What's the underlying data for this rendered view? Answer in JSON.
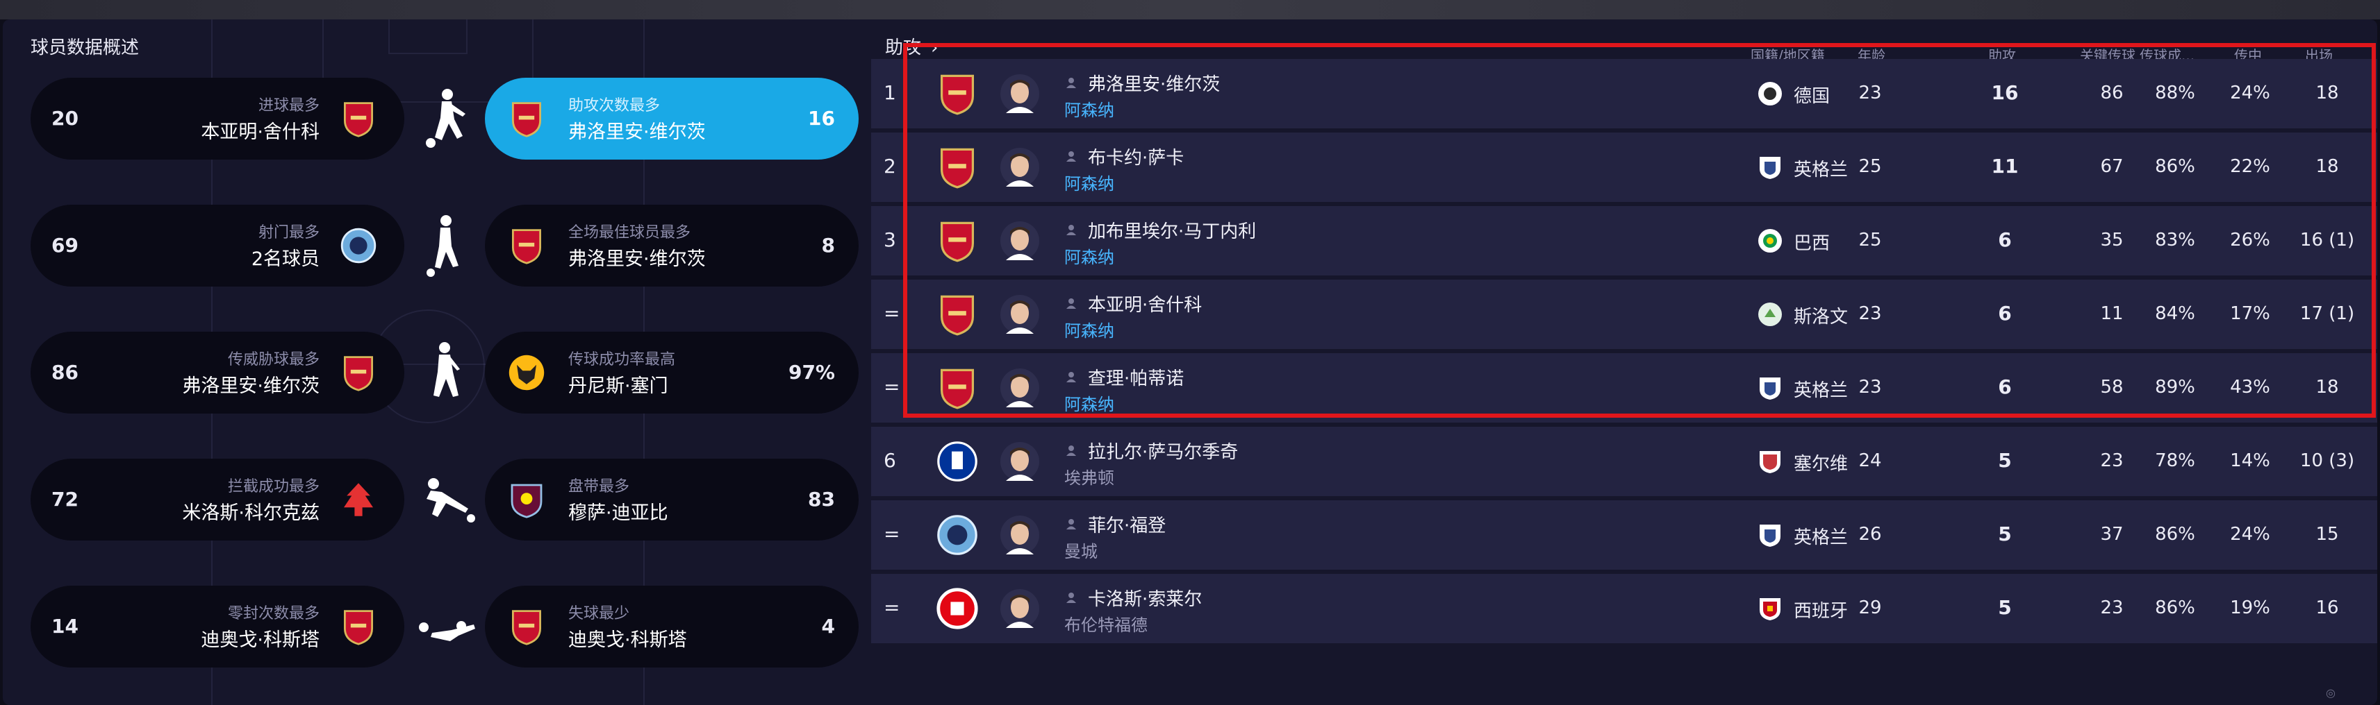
{
  "overview": {
    "title": "球员数据概述",
    "rows": [
      {
        "left": {
          "value": "20",
          "category": "进球最多",
          "player": "本亚明·舍什科",
          "crest": "arsenal-crest"
        },
        "right": {
          "value": "16",
          "category": "助攻次数最多",
          "player": "弗洛里安·维尔茨",
          "crest": "arsenal-crest",
          "highlighted": true
        }
      },
      {
        "left": {
          "value": "69",
          "category": "射门最多",
          "player": "2名球员",
          "crest": "man-city-crest"
        },
        "right": {
          "value": "8",
          "category": "全场最佳球员最多",
          "player": "弗洛里安·维尔茨",
          "crest": "arsenal-crest"
        }
      },
      {
        "left": {
          "value": "86",
          "category": "传威胁球最多",
          "player": "弗洛里安·维尔茨",
          "crest": "arsenal-crest"
        },
        "right": {
          "value": "97%",
          "category": "传球成功率最高",
          "player": "丹尼斯·塞门",
          "crest": "wolves-crest"
        }
      },
      {
        "left": {
          "value": "72",
          "category": "拦截成功最多",
          "player": "米洛斯·科尔克兹",
          "crest": "forest-crest"
        },
        "right": {
          "value": "83",
          "category": "盘带最多",
          "player": "穆萨·迪亚比",
          "crest": "villa-crest"
        }
      },
      {
        "left": {
          "value": "14",
          "category": "零封次数最多",
          "player": "迪奥戈·科斯塔",
          "crest": "arsenal-crest"
        },
        "right": {
          "value": "4",
          "category": "失球最少",
          "player": "迪奥戈·科斯塔",
          "crest": "arsenal-crest"
        }
      }
    ]
  },
  "table": {
    "title": "助攻",
    "columns": [
      "国籍/地区籍",
      "年龄",
      "助攻",
      "关键传球",
      "传球成...",
      "传中",
      "出场"
    ],
    "rows": [
      {
        "rank": "1",
        "name": "弗洛里安·维尔茨",
        "club": "阿森纳",
        "crest": "arsenal-crest",
        "nation": "德国",
        "flag": "germany-flag",
        "age": "23",
        "assists": "16",
        "key_passes": "86",
        "pass_pct": "88%",
        "cross": "24%",
        "apps": "18"
      },
      {
        "rank": "2",
        "name": "布卡约·萨卡",
        "club": "阿森纳",
        "crest": "arsenal-crest",
        "nation": "英格兰",
        "flag": "england-flag",
        "age": "25",
        "assists": "11",
        "key_passes": "67",
        "pass_pct": "86%",
        "cross": "22%",
        "apps": "18"
      },
      {
        "rank": "3",
        "name": "加布里埃尔·马丁内利",
        "club": "阿森纳",
        "crest": "arsenal-crest",
        "nation": "巴西",
        "flag": "brazil-flag",
        "age": "25",
        "assists": "6",
        "key_passes": "35",
        "pass_pct": "83%",
        "cross": "26%",
        "apps": "16 (1)"
      },
      {
        "rank": "=",
        "name": "本亚明·舍什科",
        "club": "阿森纳",
        "crest": "arsenal-crest",
        "nation": "斯洛文",
        "flag": "slovenia-flag",
        "age": "23",
        "assists": "6",
        "key_passes": "11",
        "pass_pct": "84%",
        "cross": "17%",
        "apps": "17 (1)"
      },
      {
        "rank": "=",
        "name": "查理·帕蒂诺",
        "club": "阿森纳",
        "crest": "arsenal-crest",
        "nation": "英格兰",
        "flag": "england-flag",
        "age": "23",
        "assists": "6",
        "key_passes": "58",
        "pass_pct": "89%",
        "cross": "43%",
        "apps": "18"
      },
      {
        "rank": "6",
        "name": "拉扎尔·萨马尔季奇",
        "club": "埃弗顿",
        "crest": "everton-crest",
        "nation": "塞尔维",
        "flag": "serbia-flag",
        "age": "24",
        "assists": "5",
        "key_passes": "23",
        "pass_pct": "78%",
        "cross": "14%",
        "apps": "10 (3)"
      },
      {
        "rank": "=",
        "name": "菲尔·福登",
        "club": "曼城",
        "crest": "man-city-crest",
        "nation": "英格兰",
        "flag": "england-flag",
        "age": "26",
        "assists": "5",
        "key_passes": "37",
        "pass_pct": "86%",
        "cross": "24%",
        "apps": "15"
      },
      {
        "rank": "=",
        "name": "卡洛斯·索莱尔",
        "club": "布伦特福德",
        "crest": "brentford-crest",
        "nation": "西班牙",
        "flag": "spain-flag",
        "age": "29",
        "assists": "5",
        "key_passes": "23",
        "pass_pct": "86%",
        "cross": "19%",
        "apps": "16"
      }
    ]
  },
  "colors": {
    "accent": "#1aa9e6",
    "highlight_box": "#e0161b",
    "club_link": "#48b6ff"
  }
}
